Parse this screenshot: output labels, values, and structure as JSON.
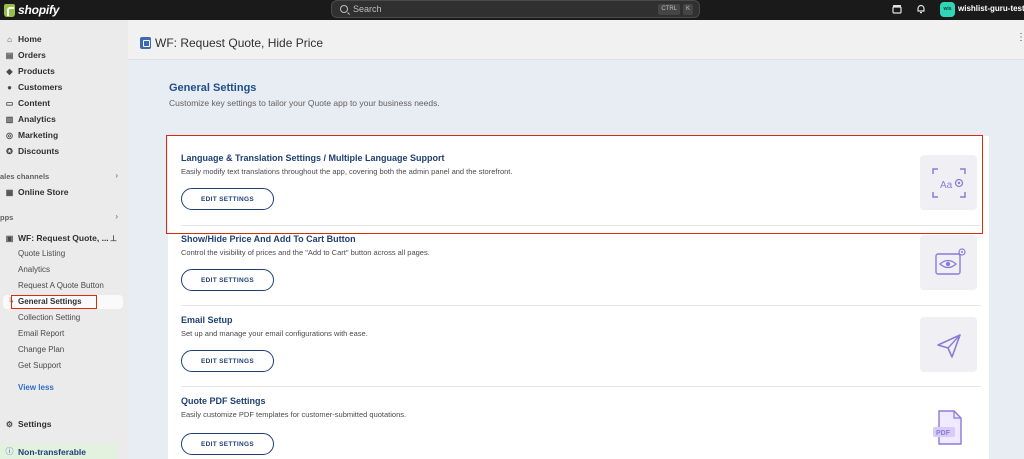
{
  "topbar": {
    "brand": "shopify",
    "search_placeholder": "Search",
    "shortcut_key1": "CTRL",
    "shortcut_key2": "K",
    "avatar_initials": "wis",
    "store_name": "wishlist-guru-testing"
  },
  "sidebar": {
    "nav": [
      {
        "label": "Home",
        "icon": "home-icon"
      },
      {
        "label": "Orders",
        "icon": "orders-icon"
      },
      {
        "label": "Products",
        "icon": "tag-icon"
      },
      {
        "label": "Customers",
        "icon": "person-icon"
      },
      {
        "label": "Content",
        "icon": "content-icon"
      },
      {
        "label": "Analytics",
        "icon": "bar-chart-icon"
      },
      {
        "label": "Marketing",
        "icon": "target-icon"
      },
      {
        "label": "Discounts",
        "icon": "discount-icon"
      }
    ],
    "sales_channels_label": "ales channels",
    "online_store": "Online Store",
    "apps_label": "pps",
    "app_name": "WF: Request Quote, ...",
    "app_sub_items": [
      "Quote Listing",
      "Analytics",
      "Request A Quote Button",
      "General Settings",
      "Collection Setting",
      "Email Report",
      "Change Plan",
      "Get Support"
    ],
    "view_less": "View less",
    "settings": "Settings",
    "non_transferable": "Non-transferable"
  },
  "titlebar": {
    "title": "WF: Request Quote, Hide Price"
  },
  "main": {
    "title": "General Settings",
    "subtitle": "Customize key settings to tailor your Quote app to your business needs.",
    "settings": [
      {
        "title": "Language & Translation Settings / Multiple Language Support",
        "desc": "Easily modify text translations throughout the app, covering both the admin panel and the storefront.",
        "button": "EDIT SETTINGS",
        "icon": "translate-icon",
        "icon_text": "Aa"
      },
      {
        "title": "Show/Hide Price And Add To Cart Button",
        "desc": "Control the visibility of prices and the \"Add to Cart\" button across all pages.",
        "button": "EDIT SETTINGS",
        "icon": "eye-icon"
      },
      {
        "title": "Email Setup",
        "desc": "Set up and manage your email configurations with ease.",
        "button": "EDIT SETTINGS",
        "icon": "send-icon"
      },
      {
        "title": "Quote PDF Settings",
        "desc": "Easily customize PDF templates for customer-submitted quotations.",
        "button": "EDIT SETTINGS",
        "icon": "pdf-icon",
        "icon_text": "PDF"
      }
    ]
  },
  "colors": {
    "accent": "#1f3f74",
    "highlight": "#d82c0d",
    "icon_purple": "#8b7bd8"
  }
}
